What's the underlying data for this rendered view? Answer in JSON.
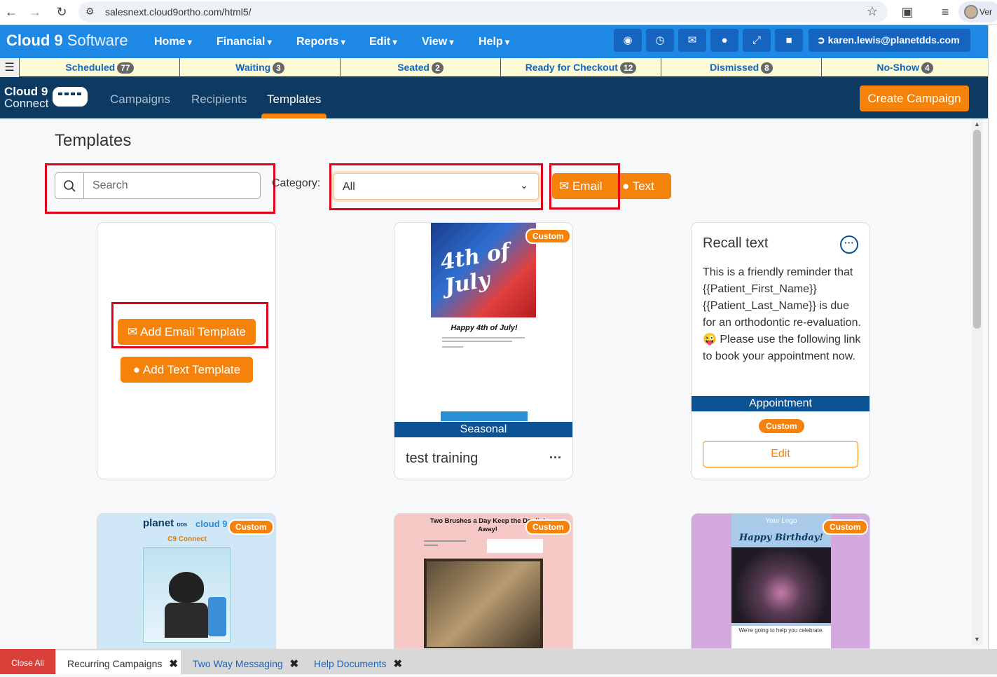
{
  "browser": {
    "url": "salesnext.cloud9ortho.com/html5/",
    "profile_label": "Ver"
  },
  "app": {
    "logo_bold": "Cloud 9",
    "logo_light": " Software",
    "menu": [
      "Home",
      "Financial",
      "Reports",
      "Edit",
      "View",
      "Help"
    ],
    "user": "karen.lewis@planetdds.com"
  },
  "status": [
    {
      "label": "Scheduled",
      "count": "77"
    },
    {
      "label": "Waiting",
      "count": "3"
    },
    {
      "label": "Seated",
      "count": "2"
    },
    {
      "label": "Ready for Checkout",
      "count": "12"
    },
    {
      "label": "Dismissed",
      "count": "8"
    },
    {
      "label": "No-Show",
      "count": "4"
    }
  ],
  "connect": {
    "logo_line1": "Cloud 9",
    "logo_line2": "Connect",
    "tabs": [
      "Campaigns",
      "Recipients",
      "Templates"
    ],
    "create_label": "Create Campaign"
  },
  "page": {
    "title": "Templates",
    "search_placeholder": "Search",
    "category_label": "Category:",
    "category_value": "All",
    "email_label": "Email",
    "text_label": "Text"
  },
  "add_card": {
    "add_email": "Add Email Template",
    "add_text": "Add Text Template"
  },
  "cards": {
    "july": {
      "badge": "Custom",
      "headline": "Happy 4th of July!",
      "category": "Seasonal",
      "name": "test training",
      "art_text": "4th of July"
    },
    "recall": {
      "title": "Recall text",
      "body": "This is a friendly reminder that {{Patient_First_Name}} {{Patient_Last_Name}} is due for an orthodontic re-evaluation. 😜 Please use the following link to book your appointment now.",
      "category": "Appointment",
      "badge": "Custom",
      "edit": "Edit"
    },
    "planet": {
      "badge": "Custom",
      "brand1": "planet",
      "brand_sub": "DDS",
      "brand2": "cloud 9",
      "subtitle": "C9 Connect"
    },
    "brushes": {
      "badge": "Custom",
      "headline": "Two Brushes a Day Keep the Dentist Away!"
    },
    "birthday": {
      "badge": "Custom",
      "logo": "Your Logo",
      "headline": "Happy Birthday!",
      "caption": "We're going to help you celebrate."
    }
  },
  "bottom_tabs": {
    "close_all": "Close All",
    "tabs": [
      "Recurring Campaigns",
      "Two Way Messaging",
      "Help Documents"
    ]
  },
  "colors": {
    "brand_blue": "#1e88e5",
    "nav_navy": "#0c3a62",
    "accent_orange": "#f5820b",
    "strip_blue": "#0b5394",
    "highlight_red": "#e0001b"
  }
}
